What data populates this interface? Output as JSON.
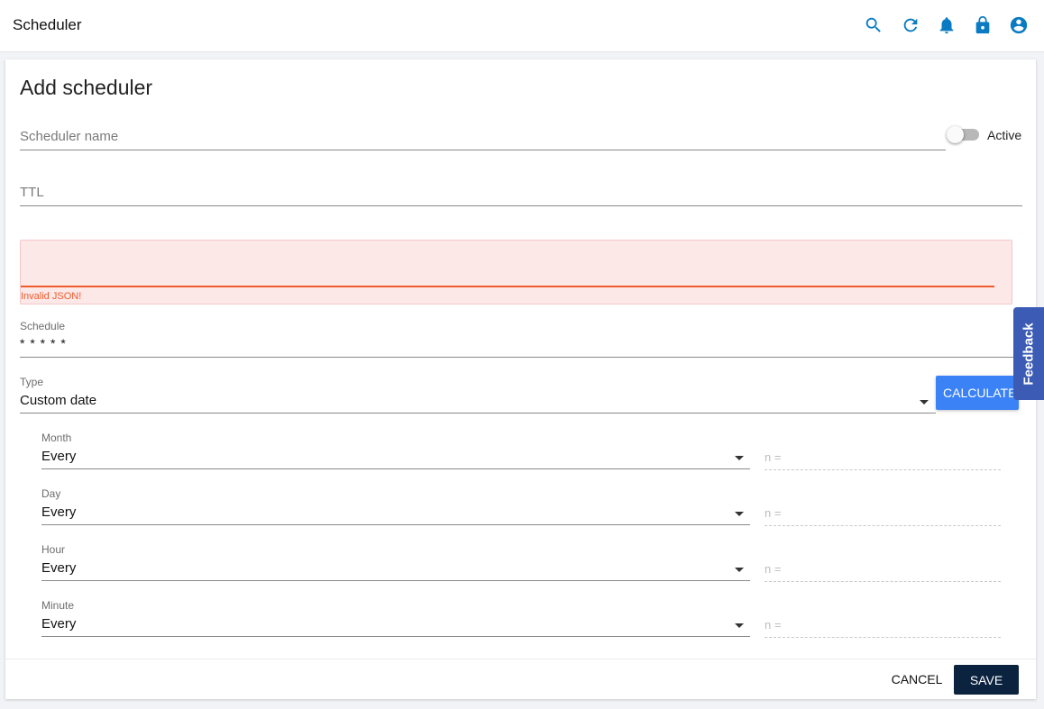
{
  "app": {
    "title": "Scheduler"
  },
  "header_icons": [
    "search-icon",
    "refresh-icon",
    "bell-icon",
    "lock-icon",
    "account-icon"
  ],
  "form": {
    "title": "Add scheduler",
    "name_placeholder": "Scheduler name",
    "active_label": "Active",
    "active": false,
    "ttl_placeholder": "TTL",
    "json_error": "Invalid JSON!",
    "schedule_label": "Schedule",
    "schedule_value": "* * * * *",
    "type_label": "Type",
    "type_value": "Custom date",
    "calculate_label": "CALCULATE",
    "parts": [
      {
        "label": "Month",
        "value": "Every",
        "n_placeholder": "n ="
      },
      {
        "label": "Day",
        "value": "Every",
        "n_placeholder": "n ="
      },
      {
        "label": "Hour",
        "value": "Every",
        "n_placeholder": "n ="
      },
      {
        "label": "Minute",
        "value": "Every",
        "n_placeholder": "n ="
      }
    ],
    "cancel_label": "CANCEL",
    "save_label": "SAVE"
  },
  "feedback": {
    "label": "Feedback"
  },
  "colors": {
    "accent_blue": "#0a7bc2",
    "calculate_button": "#3b82f6",
    "save_button": "#0c2340",
    "error": "#ef5b2a",
    "feedback_tab": "#3b5bb5"
  }
}
